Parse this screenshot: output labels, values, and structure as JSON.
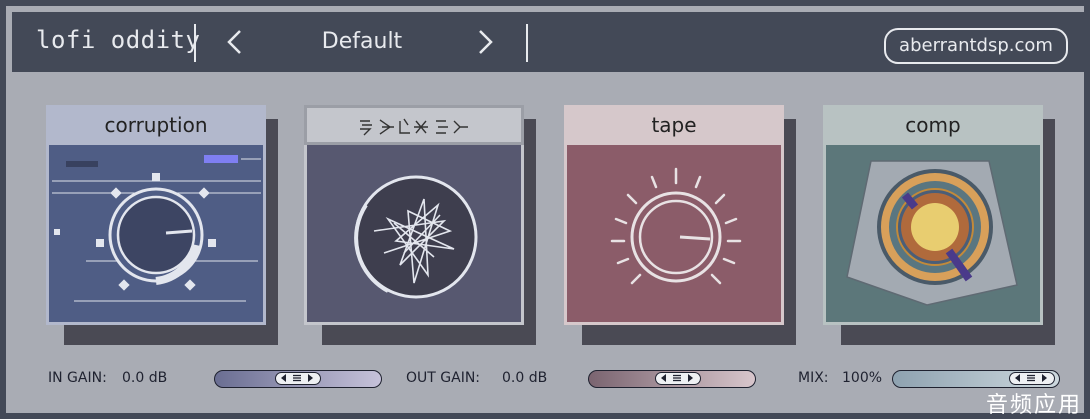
{
  "header": {
    "title": "lofi oddity",
    "preset_name": "Default",
    "website": "aberrantdsp.com"
  },
  "modules": [
    {
      "label": "corruption",
      "color": "#4f5d85",
      "tab_color": "#b2b8cc"
    },
    {
      "label": "",
      "color": "#575870",
      "tab_color": "#c4c6cc"
    },
    {
      "label": "tape",
      "color": "#8b5c69",
      "tab_color": "#d6c8cb"
    },
    {
      "label": "comp",
      "color": "#5c777a",
      "tab_color": "#b8c2c2"
    }
  ],
  "controls": {
    "in_gain_label": "IN GAIN:",
    "in_gain_value": "0.0 dB",
    "out_gain_label": "OUT GAIN:",
    "out_gain_value": "0.0 dB",
    "mix_label": "MIX:",
    "mix_value": "100%"
  },
  "watermark": "音频应用"
}
